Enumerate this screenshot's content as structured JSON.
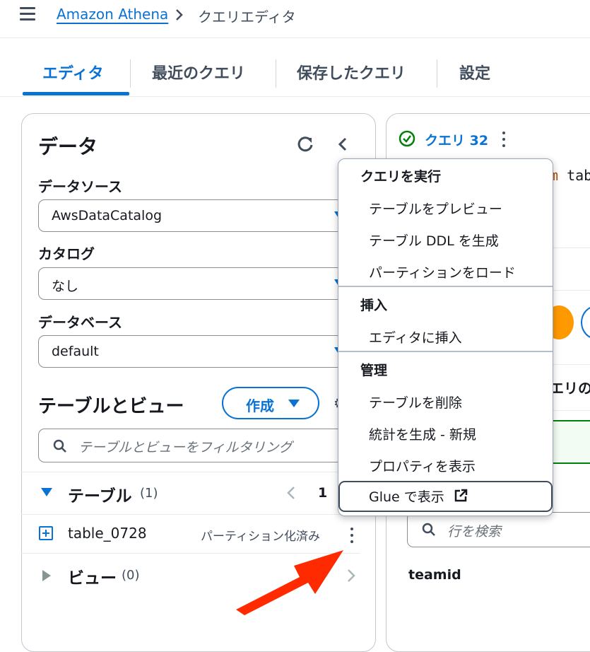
{
  "header": {
    "breadcrumb_link": "Amazon Athena",
    "breadcrumb_current": "クエリエディタ"
  },
  "tabs": [
    {
      "label": "エディタ",
      "active": true
    },
    {
      "label": "最近のクエリ"
    },
    {
      "label": "保存したクエリ"
    },
    {
      "label": "設定"
    }
  ],
  "data_panel": {
    "title": "データ",
    "datasource_label": "データソース",
    "datasource_value": "AwsDataCatalog",
    "catalog_label": "カタログ",
    "catalog_value": "なし",
    "database_label": "データベース",
    "database_value": "default",
    "tables_views_title": "テーブルとビュー",
    "create_button": "作成",
    "filter_placeholder": "テーブルとビューをフィルタリング",
    "tables_label": "テーブル",
    "tables_count": "(1)",
    "page_number": "1",
    "table_row": {
      "name": "table_0728",
      "badge": "パーティション化済み"
    },
    "views_label": "ビュー",
    "views_count": "(0)"
  },
  "query_panel": {
    "query_tab": "クエリ 32",
    "code_keyword": "m",
    "code_rest": " tab",
    "results_fragment": "エリの",
    "row_search_placeholder": "行を検索",
    "column_header": "teamid"
  },
  "context_menu": {
    "groups": [
      {
        "title": "クエリを実行",
        "items": [
          "テーブルをプレビュー",
          "テーブル DDL を生成",
          "パーティションをロード"
        ]
      },
      {
        "title": "挿入",
        "items": [
          "エディタに挿入"
        ]
      },
      {
        "title": "管理",
        "items": [
          "テーブルを削除",
          "統計を生成 - 新規",
          "プロパティを表示"
        ]
      }
    ],
    "focused_item": "Glue で表示"
  },
  "colors": {
    "accent": "#0972d3",
    "annotation_arrow": "#ff2a00",
    "success": "#037f0c",
    "orange": "#ff9900"
  }
}
